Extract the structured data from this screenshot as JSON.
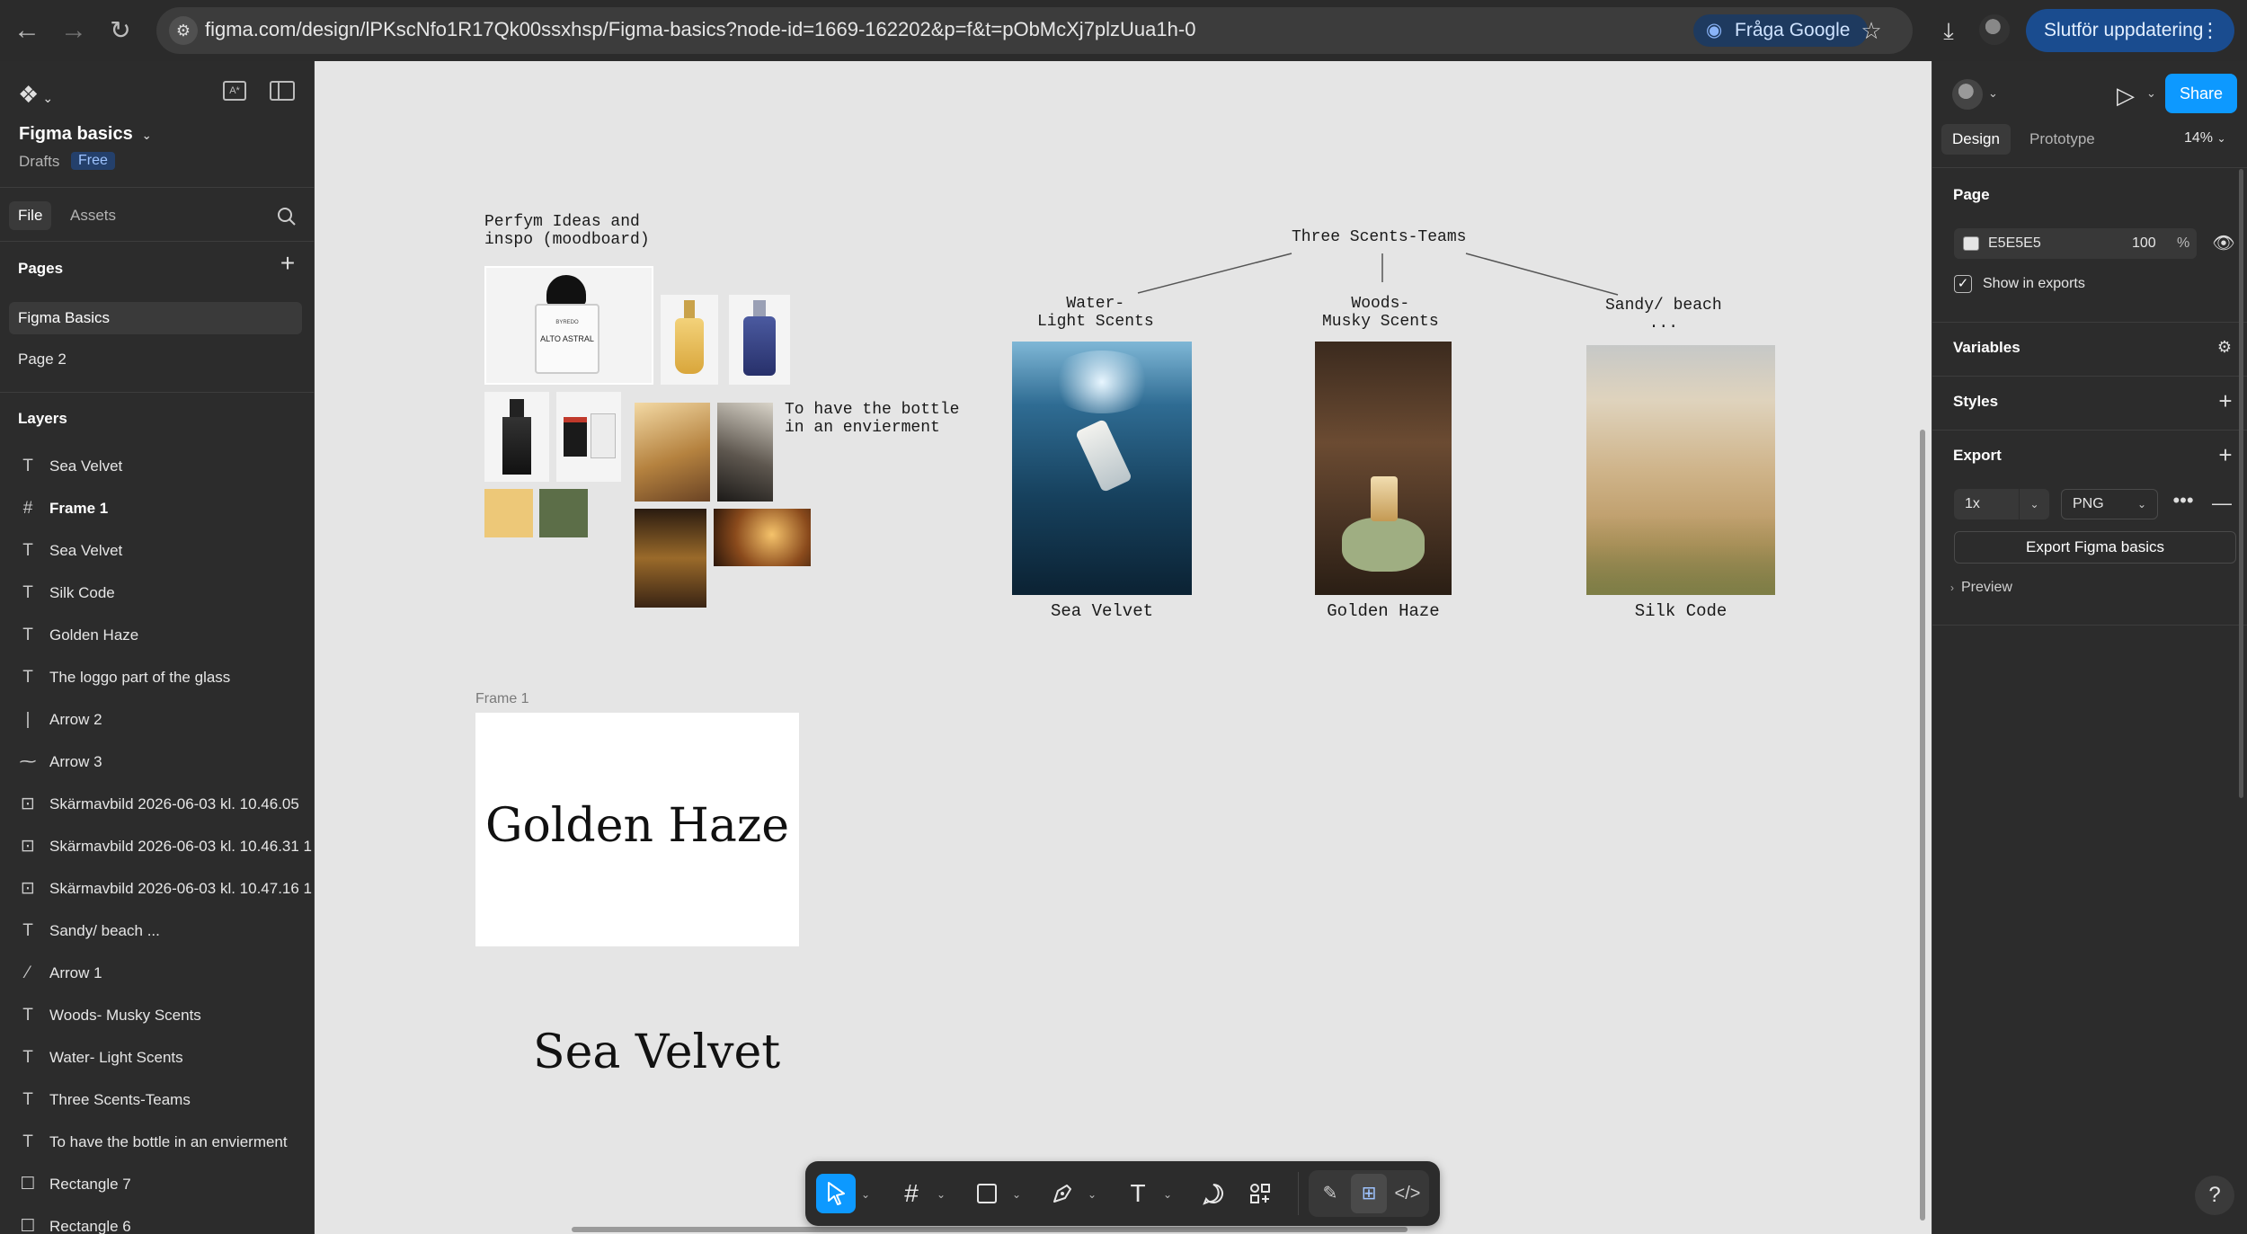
{
  "browser": {
    "url": "figma.com/design/lPKscNfo1R17Qk00ssxhsp/Figma-basics?node-id=1669-162202&p=f&t=pObMcXj7plzUua1h-0",
    "google_chip": "Fråga Google",
    "update_button": "Slutför uppdatering"
  },
  "left_panel": {
    "file_name": "Figma basics",
    "drafts": "Drafts",
    "plan_badge": "Free",
    "tabs": {
      "file": "File",
      "assets": "Assets"
    },
    "pages_header": "Pages",
    "pages": [
      "Figma Basics",
      "Page 2"
    ],
    "layers_header": "Layers",
    "layers": [
      {
        "name": "Sea Velvet",
        "icon": "text-icon"
      },
      {
        "name": "Frame 1",
        "icon": "frame-icon"
      },
      {
        "name": "Sea Velvet",
        "icon": "text-icon"
      },
      {
        "name": "Silk Code",
        "icon": "text-icon"
      },
      {
        "name": "Golden Haze",
        "icon": "text-icon"
      },
      {
        "name": "The loggo part of the glass",
        "icon": "text-icon"
      },
      {
        "name": "Arrow 2",
        "icon": "line-icon"
      },
      {
        "name": "Arrow 3",
        "icon": "line-icon"
      },
      {
        "name": "Skärmavbild 2026-06-03 kl. 10.46.05",
        "icon": "image-icon"
      },
      {
        "name": "Skärmavbild 2026-06-03 kl. 10.46.31 1",
        "icon": "image-icon"
      },
      {
        "name": "Skärmavbild 2026-06-03 kl. 10.47.16 1",
        "icon": "image-icon"
      },
      {
        "name": "Sandy/ beach  ...",
        "icon": "text-icon"
      },
      {
        "name": "Arrow 1",
        "icon": "line-icon"
      },
      {
        "name": "Woods-  Musky Scents",
        "icon": "text-icon"
      },
      {
        "name": "Water- Light Scents",
        "icon": "text-icon"
      },
      {
        "name": "Three Scents-Teams",
        "icon": "text-icon"
      },
      {
        "name": "To have the bottle in an envierment",
        "icon": "text-icon"
      },
      {
        "name": "Rectangle 7",
        "icon": "rectangle-icon"
      },
      {
        "name": "Rectangle 6",
        "icon": "rectangle-icon"
      }
    ]
  },
  "canvas": {
    "moodboard_title": "Perfym Ideas and\ninspo (moodboard)",
    "byredo_brand": "BYREDO",
    "byredo_name": "ALTO ASTRAL",
    "env_note": "To have the bottle\nin an envierment",
    "teams_title": "Three Scents-Teams",
    "team_water": "Water-\nLight Scents",
    "team_woods": "Woods-\nMusky Scents",
    "team_sandy": "Sandy/ beach\n...",
    "caption_sea": "Sea Velvet",
    "caption_golden": "Golden Haze",
    "caption_silk": "Silk Code",
    "frame_label": "Frame 1",
    "frame_title": "Golden Haze",
    "sea_velvet_text": "Sea Velvet",
    "swatch_colors": [
      "#edc878",
      "#5c6e48"
    ]
  },
  "right_panel": {
    "share": "Share",
    "tabs": {
      "design": "Design",
      "prototype": "Prototype"
    },
    "zoom": "14%",
    "page_header": "Page",
    "bg_hex": "E5E5E5",
    "bg_color": "#e5e5e5",
    "opacity": "100",
    "opacity_unit": "%",
    "show_in_exports": "Show in exports",
    "variables": "Variables",
    "styles": "Styles",
    "export_header": "Export",
    "export_scale": "1x",
    "export_format": "PNG",
    "export_button": "Export Figma basics",
    "preview": "Preview"
  }
}
